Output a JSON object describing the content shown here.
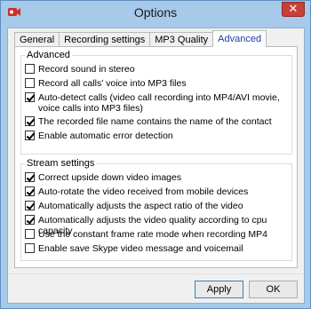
{
  "window": {
    "title": "Options",
    "close_symbol": "✕"
  },
  "tabs": [
    {
      "label": "General"
    },
    {
      "label": "Recording settings"
    },
    {
      "label": "MP3 Quality"
    },
    {
      "label": "Advanced"
    }
  ],
  "advanced": {
    "title": "Advanced",
    "options": [
      {
        "label": "Record sound in stereo",
        "checked": false
      },
      {
        "label": "Record all calls' voice into MP3 files",
        "checked": false
      },
      {
        "label": "Auto-detect calls (video call recording into MP4/AVI movie, voice calls into MP3 files)",
        "checked": true
      },
      {
        "label": "The recorded file name contains the name of the contact",
        "checked": true
      },
      {
        "label": "Enable automatic error detection",
        "checked": true
      }
    ]
  },
  "stream": {
    "title": "Stream settings",
    "options": [
      {
        "label": "Correct upside down video images",
        "checked": true
      },
      {
        "label": "Auto-rotate the video received from mobile devices",
        "checked": true
      },
      {
        "label": "Automatically adjusts the aspect ratio of the video",
        "checked": true
      },
      {
        "label": "Automatically adjusts the video quality according to cpu capacity",
        "checked": true
      },
      {
        "label": "Use the constant frame rate mode when recording MP4",
        "checked": false
      },
      {
        "label": "Enable save Skype video message and voicemail",
        "checked": false
      }
    ]
  },
  "buttons": {
    "apply": "Apply",
    "ok": "OK"
  },
  "colors": {
    "titlebar": "#a7c9ea",
    "close": "#c7403a",
    "active_tab_text": "#1a3fa3"
  }
}
